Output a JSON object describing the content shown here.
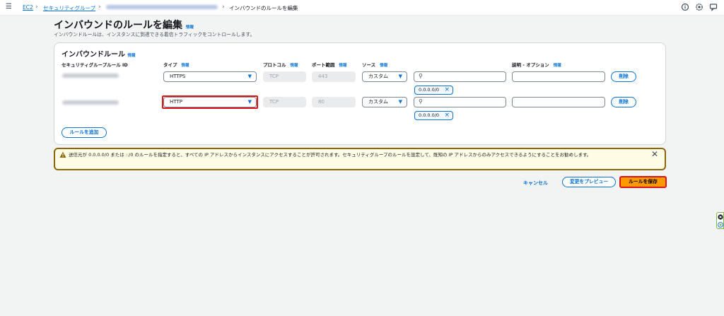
{
  "breadcrumb": {
    "ec2": "EC2",
    "security_groups": "セキュリティグループ",
    "current": "インバウンドのルールを編集"
  },
  "header": {
    "title": "インバウンドのルールを編集",
    "info": "情報",
    "description": "インバウンドルールは、インスタンスに到達できる着信トラフィックをコントロールします。"
  },
  "rules_panel": {
    "title": "インバウンドルール",
    "info": "情報",
    "columns": {
      "rule_id": "セキュリティグループルール ID",
      "type": "タイプ",
      "protocol": "プロトコル",
      "port_range": "ポート範囲",
      "source": "ソース",
      "description": "説明 - オプション",
      "info": "情報"
    },
    "rows": [
      {
        "type": "HTTPS",
        "protocol": "TCP",
        "port": "443",
        "source": "カスタム",
        "cidr": "0.0.0.0/0",
        "delete": "削除"
      },
      {
        "type": "HTTP",
        "protocol": "TCP",
        "port": "80",
        "source": "カスタム",
        "cidr": "0.0.0.0/0",
        "delete": "削除"
      }
    ],
    "add_rule": "ルールを追加"
  },
  "alert": {
    "text": "送信元が 0.0.0.0/0 または ::/0 のルールを指定すると、すべての IP アドレスからインスタンスにアクセスすることが許可されます。セキュリティグループのルールを設定して、既知の IP アドレスからのみアクセスできるようにすることをお勧めします。"
  },
  "actions": {
    "cancel": "キャンセル",
    "preview": "変更をプレビュー",
    "save": "ルールを保存"
  },
  "colors": {
    "accent": "#0972d3",
    "primary": "#ff9900",
    "highlight": "#d91515",
    "warning": "#8d6605"
  }
}
